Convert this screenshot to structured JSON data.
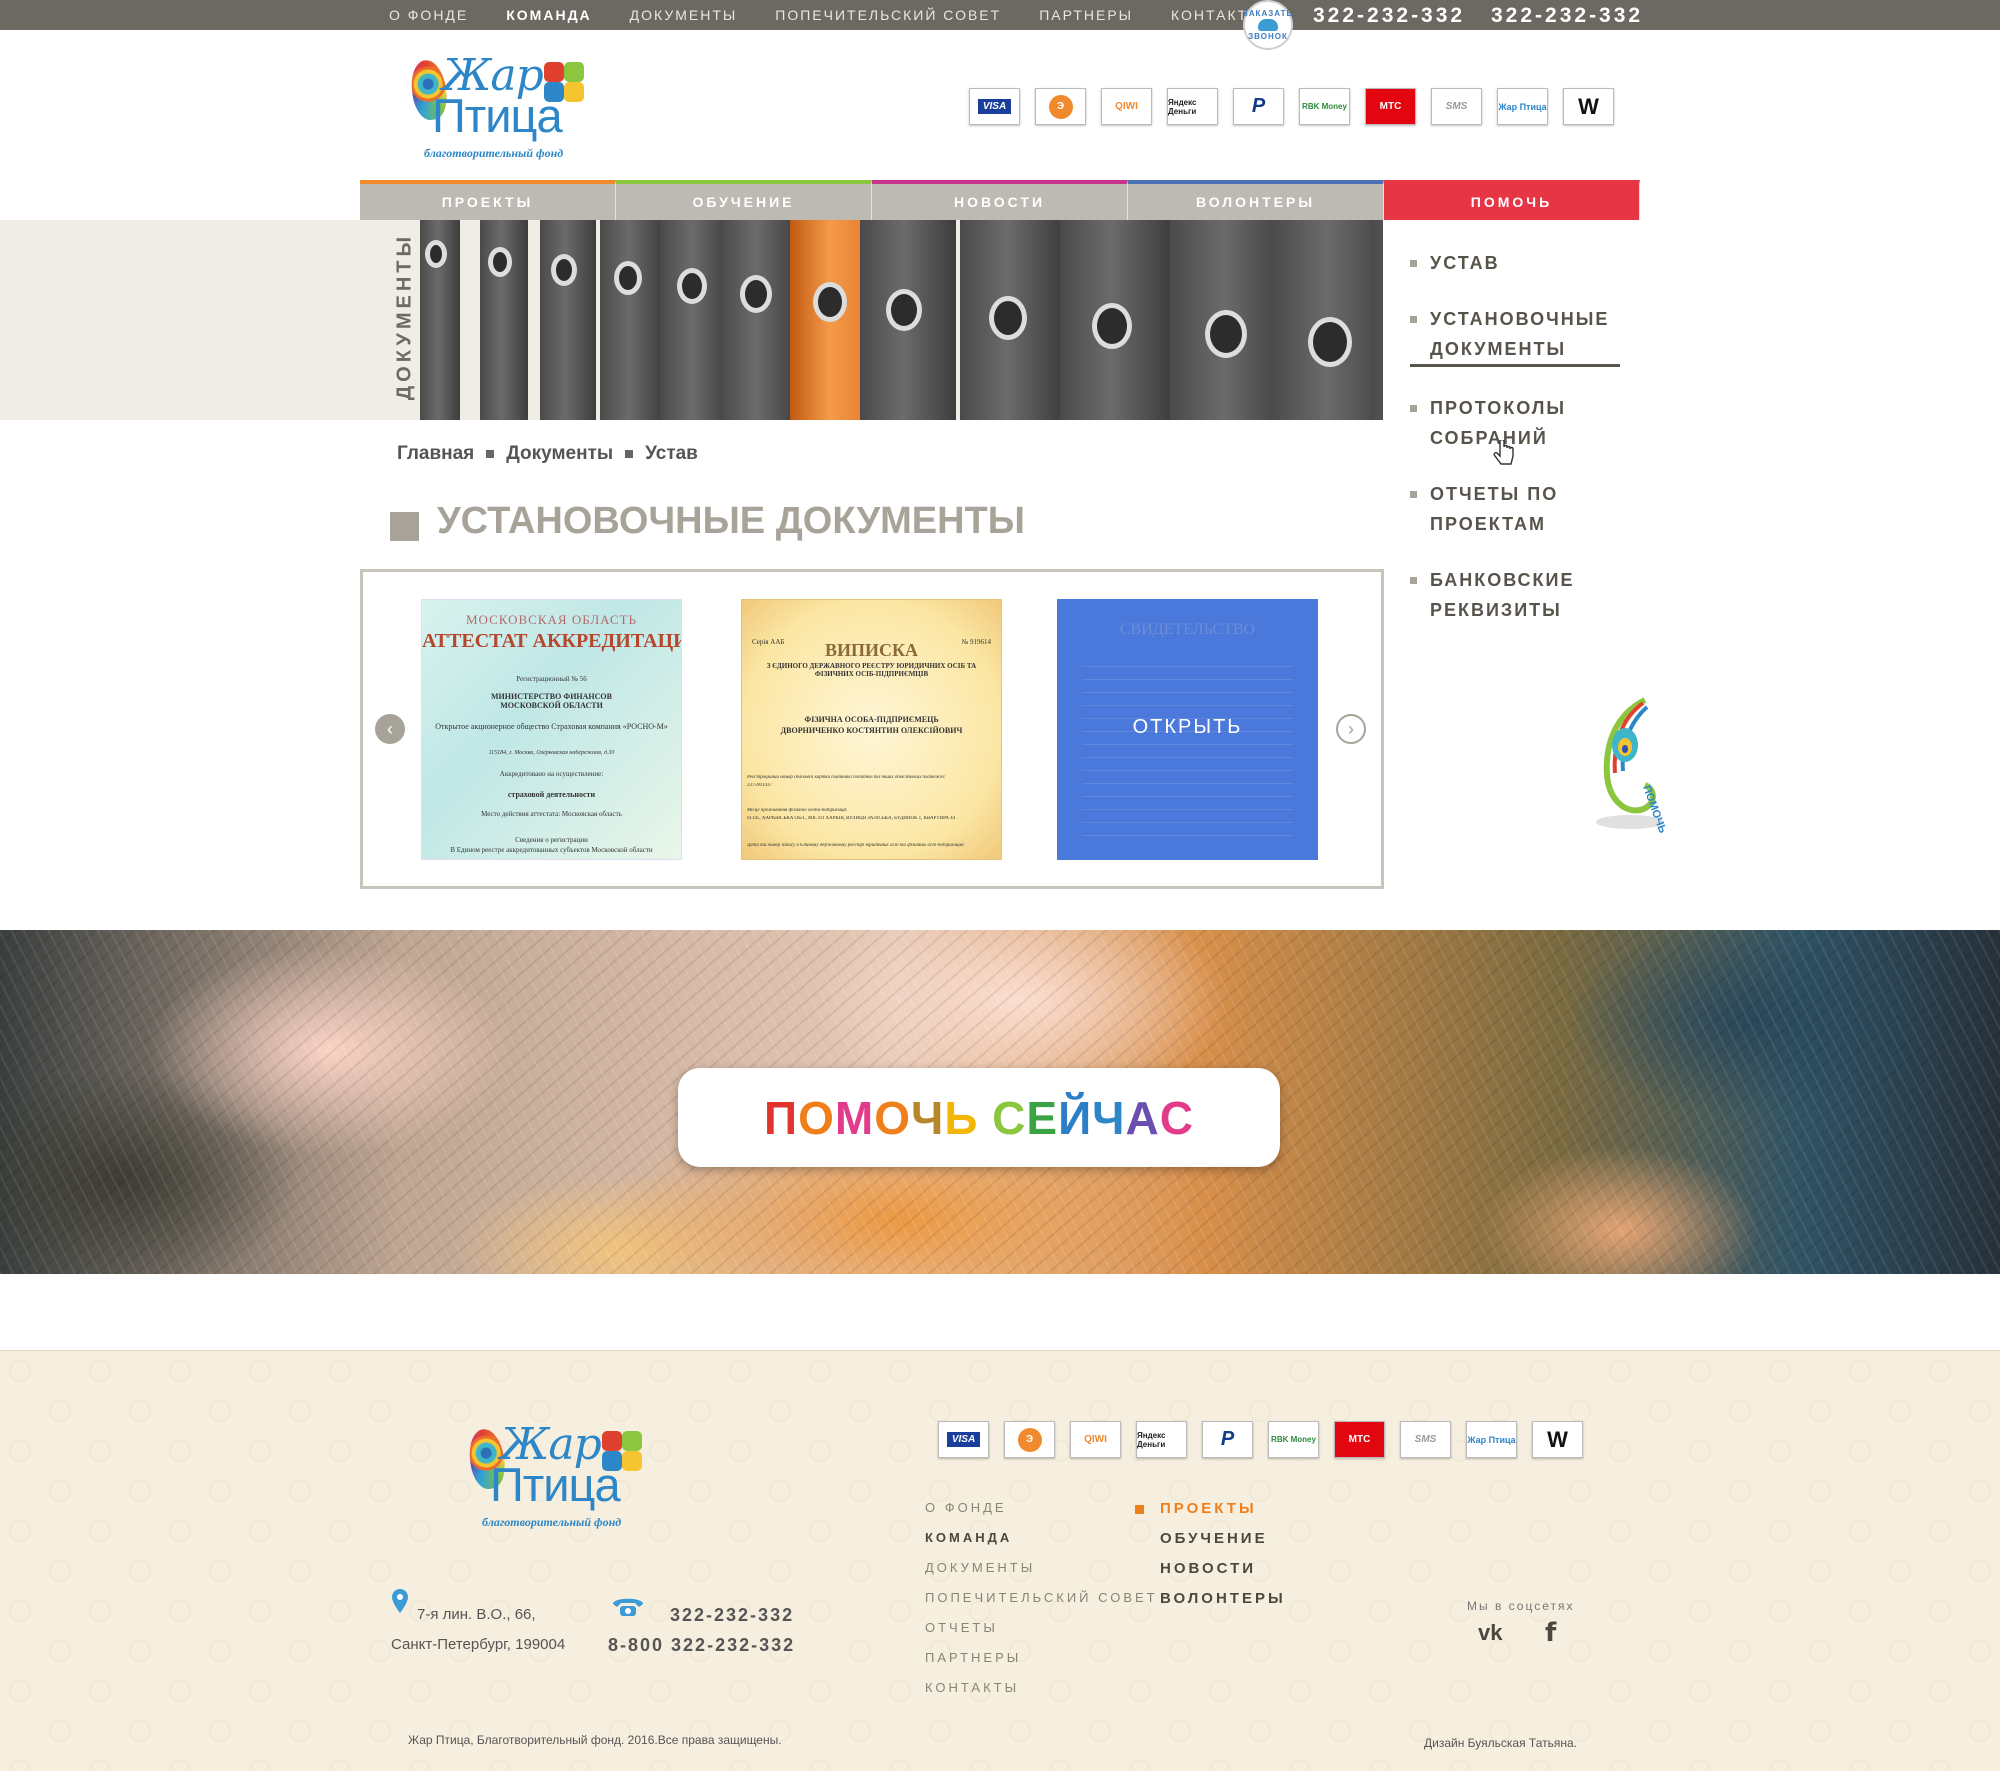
{
  "top_nav": {
    "items": [
      "О ФОНДЕ",
      "КОМАНДА",
      "ДОКУМЕНТЫ",
      "ПОПЕЧИТЕЛЬСКИЙ СОВЕТ",
      "ПАРТНЕРЫ",
      "КОНТАКТЫ"
    ],
    "active_index": 1,
    "callback_badge": [
      "ЗАКАЗАТЬ",
      "ЗВОНОК"
    ],
    "phone1": "322-232-332",
    "phone2": "322-232-332"
  },
  "logo": {
    "line1": "Жар",
    "line2": "Птица",
    "tagline": "благотворительный фонд"
  },
  "payments": [
    "VISA",
    "Э",
    "QIWI",
    "Яндекс Деньги",
    "P",
    "RBK Money",
    "МТС",
    "SMS",
    "Жар Птица",
    "W"
  ],
  "main_nav": {
    "items": [
      {
        "label": "ПРОЕКТЫ",
        "color": "#f08a2d"
      },
      {
        "label": "ОБУЧЕНИЕ",
        "color": "#8cc63f"
      },
      {
        "label": "НОВОСТИ",
        "color": "#c8338c"
      },
      {
        "label": "ВОЛОНТЕРЫ",
        "color": "#4a72b5"
      }
    ],
    "help_label": "ПОМОЧЬ",
    "help_color": "#e63646"
  },
  "banner": {
    "title": "ДОКУМЕНТЫ"
  },
  "side_menu": {
    "items": [
      {
        "label": "УСТАВ",
        "active": false
      },
      {
        "label": "УСТАНОВОЧНЫЕ ДОКУМЕНТЫ",
        "active": true
      },
      {
        "label": "ПРОТОКОЛЫ СОБРАНИЙ",
        "active": false
      },
      {
        "label": "ОТЧЕТЫ ПО ПРОЕКТАМ",
        "active": false
      },
      {
        "label": "БАНКОВСКИЕ РЕКВИЗИТЫ",
        "active": false
      }
    ]
  },
  "breadcrumb": [
    "Главная",
    "Документы",
    "Устав"
  ],
  "page_title": "УСТАНОВОЧНЫЕ ДОКУМЕНТЫ",
  "documents": {
    "doc1": {
      "region": "МОСКОВСКАЯ ОБЛАСТЬ",
      "title": "АТТЕСТАТ АККРЕДИТАЦИИ",
      "reg": "Регистрационный № 56",
      "ministry": "МИНИСТЕРСТВО ФИНАНСОВ МОСКОВСКОЙ ОБЛАСТИ",
      "company": "Открытое акционерное общество Страховая компания «РОСНО-М»",
      "address": "115184, г. Москва, Озерковская набережная, д.30",
      "accredited": "Аккредитовано на осуществление:",
      "activity": "страховой деятельности",
      "place": "Место действия аттестата: Московская область",
      "info": "Сведения о регистрации",
      "info2": "В Едином реестре аккредитованных субъектов Московской области"
    },
    "doc2": {
      "series": "Серія ААБ",
      "number": "№ 919614",
      "title": "ВИПИСКА",
      "subtitle": "З ЄДИНОГО ДЕРЖАВНОГО РЕЄСТРУ ЮРИДИЧНИХ ОСІБ ТА ФІЗИЧНИХ ОСІБ-ПІДПРИЄМЦІВ",
      "person1": "ФІЗИЧНА ОСОБА-ПІДПРИЄМЕЦЬ",
      "person2": "ДВОРНИЧЕНКО КОСТЯНТИН ОЛЕКСІЙОВИЧ",
      "reg_label": "Реєстраційний номер облікової картки платника податків та інших обов'язкових платежів:",
      "reg_no": "2375901437",
      "residence_label": "Місце проживання фізичної особи-підприємця:",
      "residence": "61145, ХАРКІВСЬКА ОБЛ., МІСТО ХАРКІВ, ВУЛИЦЯ ЗАЛІСЬКА, БУДИНОК 1, КВАРТИРА 44",
      "date_label": "Дата та номер запису в Єдиному державному реєстрі юридичних осіб та фізичних осіб-підприємців:"
    },
    "doc3": {
      "title": "СВИДЕТЕЛЬСТВО",
      "open_label": "ОТКРЫТЬ"
    }
  },
  "slider": {
    "prev": "‹",
    "next": "›"
  },
  "help_badge": "ПОМОЧЬ",
  "cta": {
    "letters": [
      {
        "ch": "П",
        "color": "#e0352f"
      },
      {
        "ch": "О",
        "color": "#ef7f1a"
      },
      {
        "ch": "М",
        "color": "#e23b8c"
      },
      {
        "ch": "О",
        "color": "#ef7f1a"
      },
      {
        "ch": "Ч",
        "color": "#b6862a"
      },
      {
        "ch": "Ь",
        "color": "#f2b705"
      },
      {
        "ch": " ",
        "color": "#000000"
      },
      {
        "ch": "С",
        "color": "#8cc63f"
      },
      {
        "ch": "Е",
        "color": "#3aa444"
      },
      {
        "ch": "Й",
        "color": "#2c7fc7"
      },
      {
        "ch": "Ч",
        "color": "#2c86c7"
      },
      {
        "ch": "А",
        "color": "#6a4fb0"
      },
      {
        "ch": "С",
        "color": "#e23b8c"
      }
    ]
  },
  "footer": {
    "nav1": [
      "О ФОНДЕ",
      "КОМАНДА",
      "ДОКУМЕНТЫ",
      "ПОПЕЧИТЕЛЬСКИЙ СОВЕТ",
      "ОТЧЕТЫ",
      "ПАРТНЕРЫ",
      "КОНТАКТЫ"
    ],
    "nav1_bold_index": 1,
    "nav2": [
      "ПРОЕКТЫ",
      "ОБУЧЕНИЕ",
      "НОВОСТИ",
      "ВОЛОНТЕРЫ"
    ],
    "address1": "7-я лин. В.О., 66,",
    "address2": "Санкт-Петербург, 199004",
    "phone1": "322-232-332",
    "phone2": "8-800 322-232-332",
    "social_title": "Мы в соцсетях",
    "vk": "vk",
    "fb": "f",
    "copyright": "Жар Птица, Благотворительный фонд. 2016.Все права защищены.",
    "designer": "Дизайн Буяльская Татьяна."
  }
}
